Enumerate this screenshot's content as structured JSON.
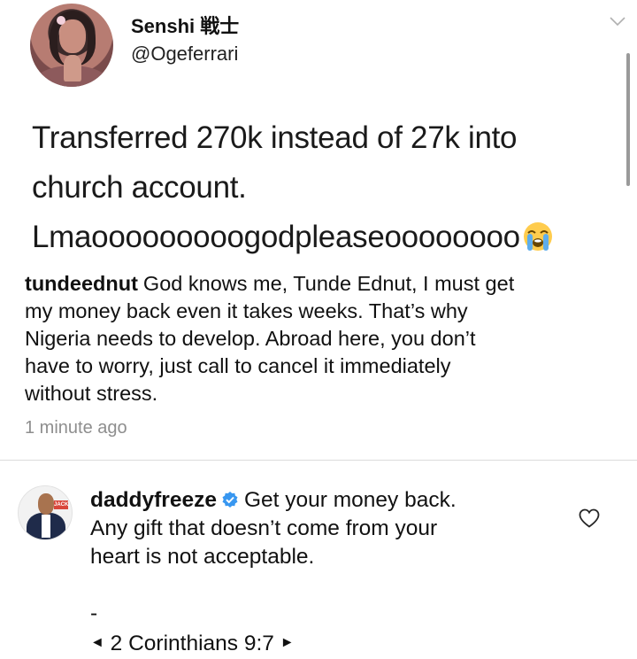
{
  "tweet": {
    "display_name": "Senshi 戦士",
    "handle": "@Ogeferrari",
    "text_lines": [
      "Transferred 270k instead of 27k into",
      "church account.",
      "Lmaooooooooogodpleaseoooooooo"
    ],
    "emoji_icon": "loudly-crying-face-icon"
  },
  "post_caption": {
    "author": "tundeednut",
    "lines": [
      "God knows me, Tunde Ednut, I must get",
      "my money back even it takes weeks. That’s why",
      "Nigeria needs to develop. Abroad here, you don’t",
      "have to worry, just call to cancel it immediately",
      "without stress."
    ],
    "timestamp": "1 minute ago"
  },
  "comment": {
    "author": "daddyfreeze",
    "verified_icon": "verified-badge-icon",
    "lines": [
      "Get your money back.",
      "Any gift that doesn’t come from your",
      "heart is not acceptable."
    ],
    "dash": "-",
    "verse": "2 Corinthians 9:7",
    "verse_left_marker": "◄",
    "verse_right_marker": "►",
    "like_icon": "heart-outline-icon"
  },
  "colors": {
    "text": "#111111",
    "secondary_text": "#8e8e8e",
    "divider": "#dbdbdb",
    "verified_blue": "#3897f0"
  }
}
